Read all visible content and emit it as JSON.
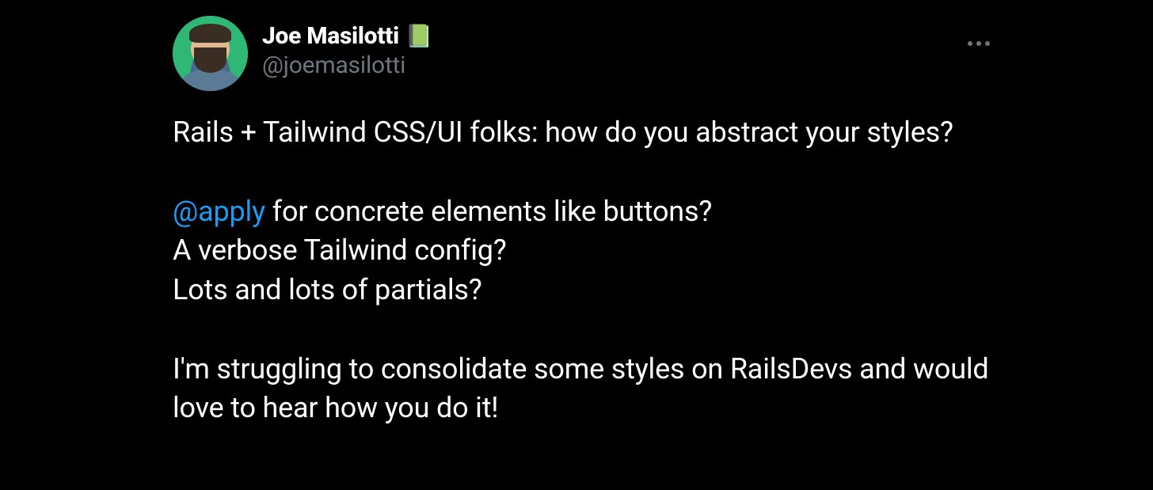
{
  "tweet": {
    "author": {
      "display_name": "Joe Masilotti",
      "emoji": "📗",
      "handle": "@joemasilotti"
    },
    "body": {
      "paragraphs": [
        {
          "lines": [
            {
              "text": "Rails + Tailwind CSS/UI folks: how do you abstract your styles?"
            }
          ]
        },
        {
          "lines": [
            {
              "mention": "@apply",
              "text": " for concrete elements like buttons?"
            },
            {
              "text": "A verbose Tailwind config?"
            },
            {
              "text": "Lots and lots of partials?"
            }
          ]
        },
        {
          "lines": [
            {
              "text": "I'm struggling to consolidate some styles on RailsDevs and would love to hear how you do it!"
            }
          ]
        }
      ]
    }
  }
}
